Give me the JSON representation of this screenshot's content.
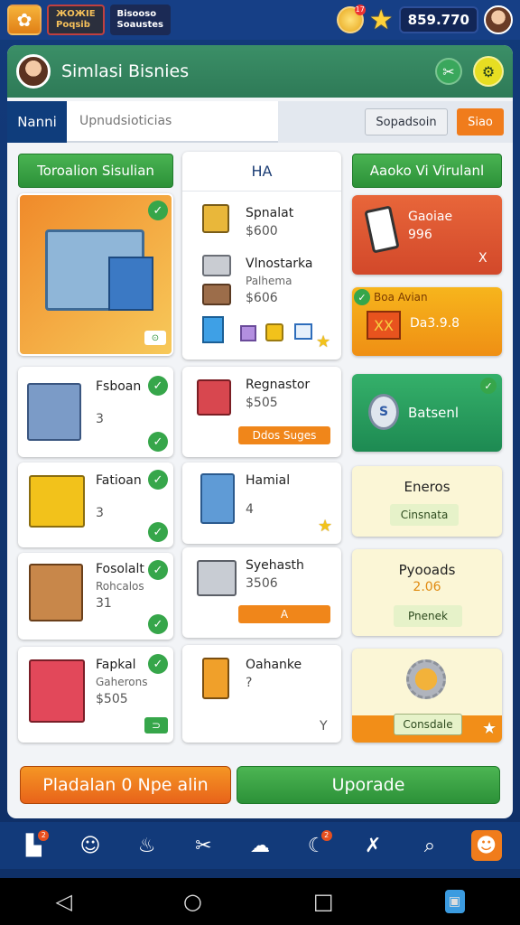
{
  "topbar": {
    "store_line1": "ЖОЖІЕ",
    "store_line2": "Poqsib",
    "title_line1": "Bisooso",
    "title_line2": "Soaustes",
    "coin_badge": "17",
    "money": "859.770"
  },
  "header": {
    "title": "Simlasi Bisnies"
  },
  "tabs": {
    "active": "Nanni",
    "search_placeholder": "Upnudsioticias",
    "search_button": "Sopadsoin",
    "orange_tab": "Siao"
  },
  "left_column": {
    "header": "Toroalion Sisulian",
    "cards": [
      {
        "title": "Fsboan",
        "value": "3"
      },
      {
        "title": "Fatioan",
        "value": "3"
      },
      {
        "title": "Fosolalt",
        "sub": "Rohcalos",
        "value": "31"
      },
      {
        "title": "Fapkal",
        "sub": "Gaherons",
        "value": "$505"
      }
    ]
  },
  "middle_column": {
    "header": "HA",
    "top_items": [
      {
        "title": "Spnalat",
        "value": "$600"
      },
      {
        "title": "Vlnostarka",
        "sub": "Palhema",
        "value": "$606"
      }
    ],
    "cards": [
      {
        "title": "Regnastor",
        "value": "$505",
        "pill": "Ddos Suges"
      },
      {
        "title": "Hamial",
        "value": "4"
      },
      {
        "title": "Syehasth",
        "value": "3506",
        "pill": "A"
      },
      {
        "title": "Oahanke",
        "value": "?",
        "corner": "Y"
      }
    ]
  },
  "right_column": {
    "header": "Aaoko Vi Virulanl",
    "card1": {
      "title": "Gaoiae",
      "value": "996",
      "corner": "X"
    },
    "card2": {
      "label": "Boa Avian",
      "box": "XX",
      "value": "Da3.9.8"
    },
    "card3": {
      "title": "Batsenl"
    },
    "card4": {
      "title": "Eneros",
      "button": "Cinsnata"
    },
    "card5": {
      "title": "Pyooads",
      "value": "2.06",
      "button": "Pnenek"
    },
    "card6": {
      "button": "Consdale"
    }
  },
  "actions": {
    "left": "Pladalan 0 Npe alin",
    "right": "Uporade"
  },
  "bottom_nav": {
    "badge1": "2",
    "badge2": "2"
  },
  "colors": {
    "green": "#2c9138",
    "orange": "#f07c1c",
    "navy": "#123a7a"
  }
}
